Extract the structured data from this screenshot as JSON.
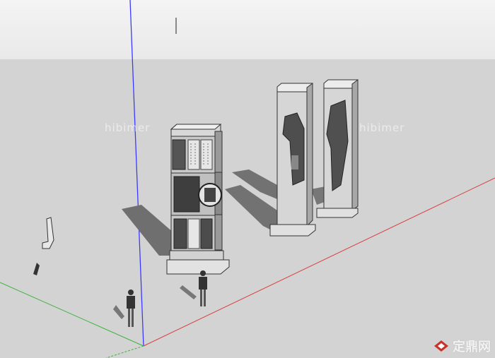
{
  "watermark": {
    "left_text": "hibimer",
    "right_text": "hibimer",
    "logo_text": "定鼎网"
  },
  "colors": {
    "sky": "#eeeeee",
    "ground": "#d3d3d3",
    "axis_blue": "#3a3aff",
    "axis_red": "#d84040",
    "axis_green": "#3fb33f",
    "logo_red": "#c8322b"
  },
  "icons": {
    "logo": "dingding-logo-icon"
  }
}
